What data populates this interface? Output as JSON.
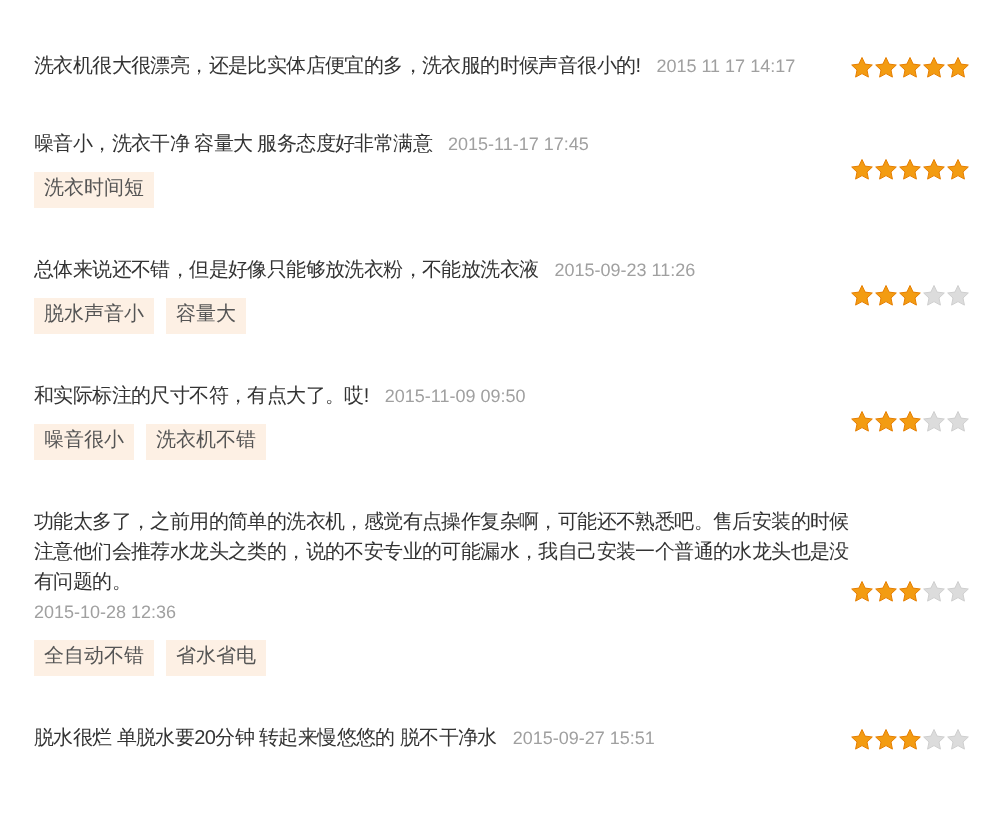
{
  "reviews": [
    {
      "comment": "洗衣机很大很漂亮，还是比实体店便宜的多，洗衣服的时候声音很小的!",
      "date": "2015 11 17 14:17",
      "stars": 5
    },
    {
      "comment": "噪音小，洗衣干净 容量大 服务态度好非常满意",
      "date": "2015-11-17 17:45",
      "tags": [
        "洗衣时间短"
      ],
      "stars": 5
    },
    {
      "comment": "总体来说还不错，但是好像只能够放洗衣粉，不能放洗衣液",
      "date": "2015-09-23 11:26",
      "tags": [
        "脱水声音小",
        "容量大"
      ],
      "stars": 3
    },
    {
      "comment": "和实际标注的尺寸不符，有点大了。哎!",
      "date": "2015-11-09 09:50",
      "tags": [
        "噪音很小",
        "洗衣机不错"
      ],
      "stars": 3
    },
    {
      "comment": "功能太多了，之前用的简单的洗衣机，感觉有点操作复杂啊，可能还不熟悉吧。售后安装的时候注意他们会推荐水龙头之类的，说的不安专业的可能漏水，我自己安装一个普通的水龙头也是没有问题的。",
      "date": "2015-10-28 12:36",
      "tags": [
        "全自动不错",
        "省水省电"
      ],
      "stars": 3
    },
    {
      "comment": "脱水很烂 单脱水要20分钟 转起来慢悠悠的 脱不干净水",
      "date": "2015-09-27 15:51",
      "stars": 3
    }
  ]
}
